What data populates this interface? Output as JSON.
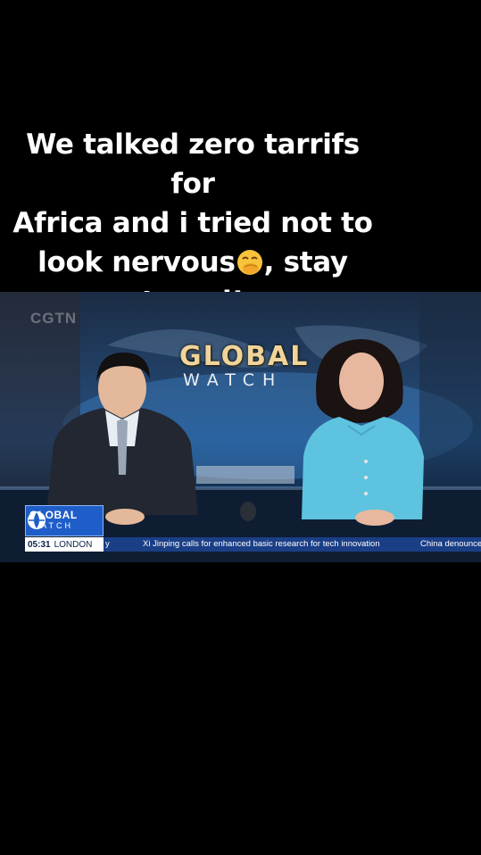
{
  "caption": {
    "line1": "We talked zero tarrifs for",
    "line2": "Africa and i tried not to",
    "line3_before": "look nervous",
    "emoji": "face-with-hand-over-mouth-icon",
    "line3_after": ", stay",
    "line4": "tuned!"
  },
  "video": {
    "watermark": "CGTN",
    "backdrop_title": "GLOBAL",
    "backdrop_subtitle": "WATCH",
    "lower_third": {
      "logo_line1": "GLOBAL",
      "logo_line2": "WATCH",
      "time": "05:31",
      "city": "LONDON",
      "ticker_prev_tail": "y",
      "ticker_headline": "Xi Jinping calls for enhanced basic research for tech innovation",
      "ticker_next": "China denounce"
    }
  }
}
